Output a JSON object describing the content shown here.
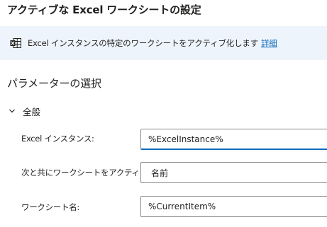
{
  "header": {
    "title": "アクティブな Excel ワークシートの設定"
  },
  "info": {
    "icon": "excel-worksheet-icon",
    "text": "Excel インスタンスの特定のワークシートをアクティブ化します",
    "link": "詳細"
  },
  "params": {
    "section_title": "パラメーターの選択",
    "group": {
      "label": "全般",
      "state": "expanded",
      "icon": "chevron-down-icon"
    },
    "fields": [
      {
        "label": "Excel インスタンス:",
        "value": "%ExcelInstance%"
      },
      {
        "label": "次と共にワークシートをアクティブ化:",
        "value": "名前"
      },
      {
        "label": "ワークシート名:",
        "value": "%CurrentItem%"
      }
    ]
  },
  "colors": {
    "accent": "#0f6cbd",
    "info_bg": "#eef4fb",
    "border": "#8a8886"
  }
}
